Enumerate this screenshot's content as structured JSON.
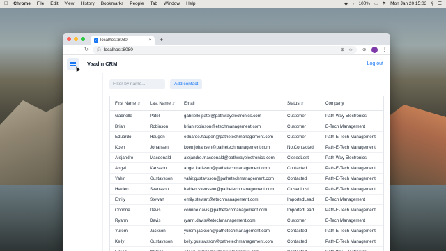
{
  "menubar": {
    "app_name": "Chrome",
    "items": [
      "File",
      "Edit",
      "View",
      "History",
      "Bookmarks",
      "People",
      "Tab",
      "Window",
      "Help"
    ],
    "battery": "100%",
    "clock": "Mon Jan 20  15:03"
  },
  "browser": {
    "tab_title": "localhost:8080",
    "address": "localhost:8080"
  },
  "app": {
    "title": "Vaadin CRM",
    "logout_label": "Log out",
    "filter_placeholder": "Filter by name...",
    "add_contact_label": "Add contact"
  },
  "grid": {
    "columns": [
      "First Name",
      "Last Name",
      "Email",
      "Status",
      "Company"
    ],
    "rows": [
      [
        "Gabrielle",
        "Patel",
        "gabrielle.patel@pathwayelectronics.com",
        "Customer",
        "Path-Way Electronics"
      ],
      [
        "Brian",
        "Robinson",
        "brian.robinson@etechmanagement.com",
        "Customer",
        "E-Tech Management"
      ],
      [
        "Eduardo",
        "Haugen",
        "eduardo.haugen@pathetechmanagement.com",
        "Customer",
        "Path-E-Tech Management"
      ],
      [
        "Koen",
        "Johansen",
        "koen.johansen@pathetechmanagement.com",
        "NotContacted",
        "Path-E-Tech Management"
      ],
      [
        "Alejandro",
        "Macdonald",
        "alejandro.macdonald@pathwayelectronics.com",
        "ClosedLost",
        "Path-Way Electronics"
      ],
      [
        "Angel",
        "Karlsson",
        "angel.karlsson@pathetechmanagement.com",
        "Contacted",
        "Path-E-Tech Management"
      ],
      [
        "Yahir",
        "Gustavsson",
        "yahir.gustavsson@pathetechmanagement.com",
        "Contacted",
        "Path-E-Tech Management"
      ],
      [
        "Haiden",
        "Svensson",
        "haiden.svensson@pathetechmanagement.com",
        "ClosedLost",
        "Path-E-Tech Management"
      ],
      [
        "Emily",
        "Stewart",
        "emily.stewart@etechmanagement.com",
        "ImportedLead",
        "E-Tech Management"
      ],
      [
        "Corinne",
        "Davis",
        "corinne.davis@pathetechmanagement.com",
        "ImportedLead",
        "Path-E-Tech Management"
      ],
      [
        "Ryann",
        "Davis",
        "ryann.davis@etechmanagement.com",
        "Customer",
        "E-Tech Management"
      ],
      [
        "Yurem",
        "Jackson",
        "yurem.jackson@pathetechmanagement.com",
        "Contacted",
        "Path-E-Tech Management"
      ],
      [
        "Kelly",
        "Gustavsson",
        "kelly.gustavsson@pathetechmanagement.com",
        "Contacted",
        "Path-E-Tech Management"
      ],
      [
        "Eileen",
        "Walker",
        "eileen.walker@pathwayelectronics.com",
        "Contacted",
        "Path-Way Electronics"
      ]
    ]
  },
  "colors": {
    "accent": "#1676f3",
    "button_bg": "#e8eef7"
  }
}
